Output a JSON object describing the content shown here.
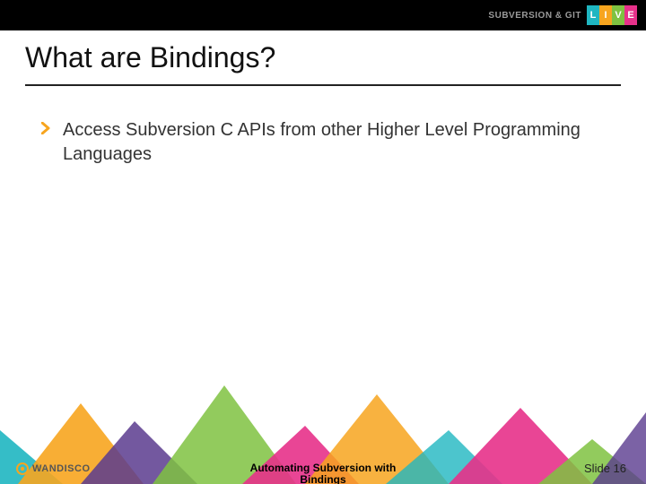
{
  "header": {
    "brand_text": "SUBVERSION & GIT",
    "live_letters": [
      "L",
      "I",
      "V",
      "E"
    ]
  },
  "title": "What are Bindings?",
  "bullets": [
    "Access Subversion C APIs from other Higher Level Programming Languages"
  ],
  "footer": {
    "presentation_title_line1": "Automating Subversion with",
    "presentation_title_line2": "Bindings",
    "slide_label": "Slide 16",
    "company": "WANDISCO"
  },
  "colors": {
    "teal": "#1fb6c1",
    "orange": "#f7a51f",
    "green": "#7fc241",
    "magenta": "#e7318a",
    "purple": "#5a3b8e"
  }
}
